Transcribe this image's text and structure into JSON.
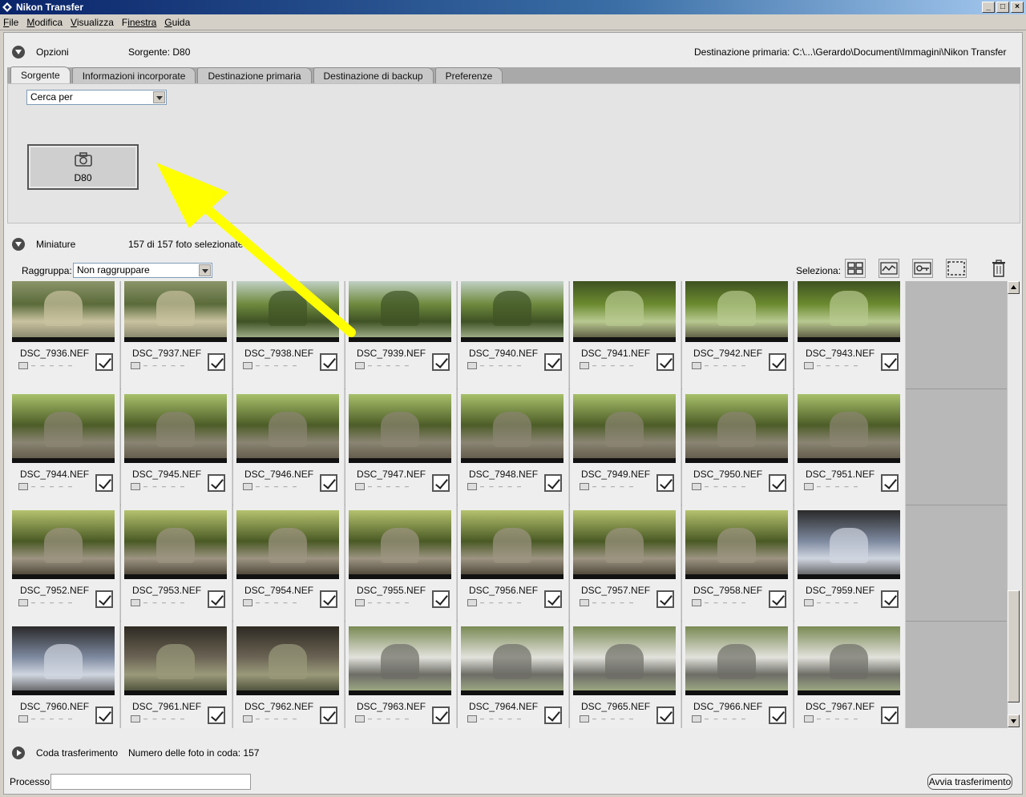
{
  "window": {
    "title": "Nikon Transfer"
  },
  "menu": [
    {
      "label": "File",
      "ul": "F",
      "rest": "ile"
    },
    {
      "label": "Modifica",
      "ul": "M",
      "rest": "odifica"
    },
    {
      "label": "Visualizza",
      "ul": "V",
      "rest": "isualizza"
    },
    {
      "label": "Finestra",
      "ul": "F",
      "rest": "inestra"
    },
    {
      "label": "Guida",
      "ul": "G",
      "rest": "uida"
    }
  ],
  "options": {
    "title": "Opzioni",
    "source": "Sorgente: D80",
    "destination": "Destinazione primaria:  C:\\...\\Gerardo\\Documenti\\Immagini\\Nikon Transfer",
    "tabs": [
      "Sorgente",
      "Informazioni incorporate",
      "Destinazione primaria",
      "Destinazione di backup",
      "Preferenze"
    ],
    "active_tab": "Sorgente",
    "search_select": "Cerca per",
    "device_label": "D80"
  },
  "thumbnails": {
    "title": "Miniature",
    "count": "157 di 157 foto selezionate",
    "group_label": "Raggruppa:",
    "group_value": "Non raggruppare",
    "select_label": "Seleziona:"
  },
  "photos": [
    {
      "name": "DSC_7936.NEF",
      "scene": "garden"
    },
    {
      "name": "DSC_7937.NEF",
      "scene": "garden"
    },
    {
      "name": "DSC_7938.NEF",
      "scene": "tree"
    },
    {
      "name": "DSC_7939.NEF",
      "scene": "tree"
    },
    {
      "name": "DSC_7940.NEF",
      "scene": "tree"
    },
    {
      "name": "DSC_7941.NEF",
      "scene": "forest"
    },
    {
      "name": "DSC_7942.NEF",
      "scene": "forest"
    },
    {
      "name": "DSC_7943.NEF",
      "scene": "forest"
    },
    {
      "name": "DSC_7944.NEF",
      "scene": "cave"
    },
    {
      "name": "DSC_7945.NEF",
      "scene": "cave"
    },
    {
      "name": "DSC_7946.NEF",
      "scene": "cave"
    },
    {
      "name": "DSC_7947.NEF",
      "scene": "cave"
    },
    {
      "name": "DSC_7948.NEF",
      "scene": "cave"
    },
    {
      "name": "DSC_7949.NEF",
      "scene": "cave"
    },
    {
      "name": "DSC_7950.NEF",
      "scene": "cave"
    },
    {
      "name": "DSC_7951.NEF",
      "scene": "cave"
    },
    {
      "name": "DSC_7952.NEF",
      "scene": "ogre"
    },
    {
      "name": "DSC_7953.NEF",
      "scene": "ogre"
    },
    {
      "name": "DSC_7954.NEF",
      "scene": "ogre"
    },
    {
      "name": "DSC_7955.NEF",
      "scene": "ogre"
    },
    {
      "name": "DSC_7956.NEF",
      "scene": "ogre"
    },
    {
      "name": "DSC_7957.NEF",
      "scene": "ogre"
    },
    {
      "name": "DSC_7958.NEF",
      "scene": "ogre"
    },
    {
      "name": "DSC_7959.NEF",
      "scene": "interior"
    },
    {
      "name": "DSC_7960.NEF",
      "scene": "interior"
    },
    {
      "name": "DSC_7961.NEF",
      "scene": "dark"
    },
    {
      "name": "DSC_7962.NEF",
      "scene": "dark"
    },
    {
      "name": "DSC_7963.NEF",
      "scene": "house"
    },
    {
      "name": "DSC_7964.NEF",
      "scene": "house"
    },
    {
      "name": "DSC_7965.NEF",
      "scene": "house"
    },
    {
      "name": "DSC_7966.NEF",
      "scene": "house"
    },
    {
      "name": "DSC_7967.NEF",
      "scene": "house"
    }
  ],
  "queue": {
    "title": "Coda trasferimento",
    "count": "Numero delle foto in coda: 157"
  },
  "process": {
    "label": "Processo:",
    "value": "",
    "start_button": "Avvia trasferimento"
  },
  "colors": {
    "annotation_arrow": "#ffff00",
    "titlebar": "#0a246a"
  }
}
